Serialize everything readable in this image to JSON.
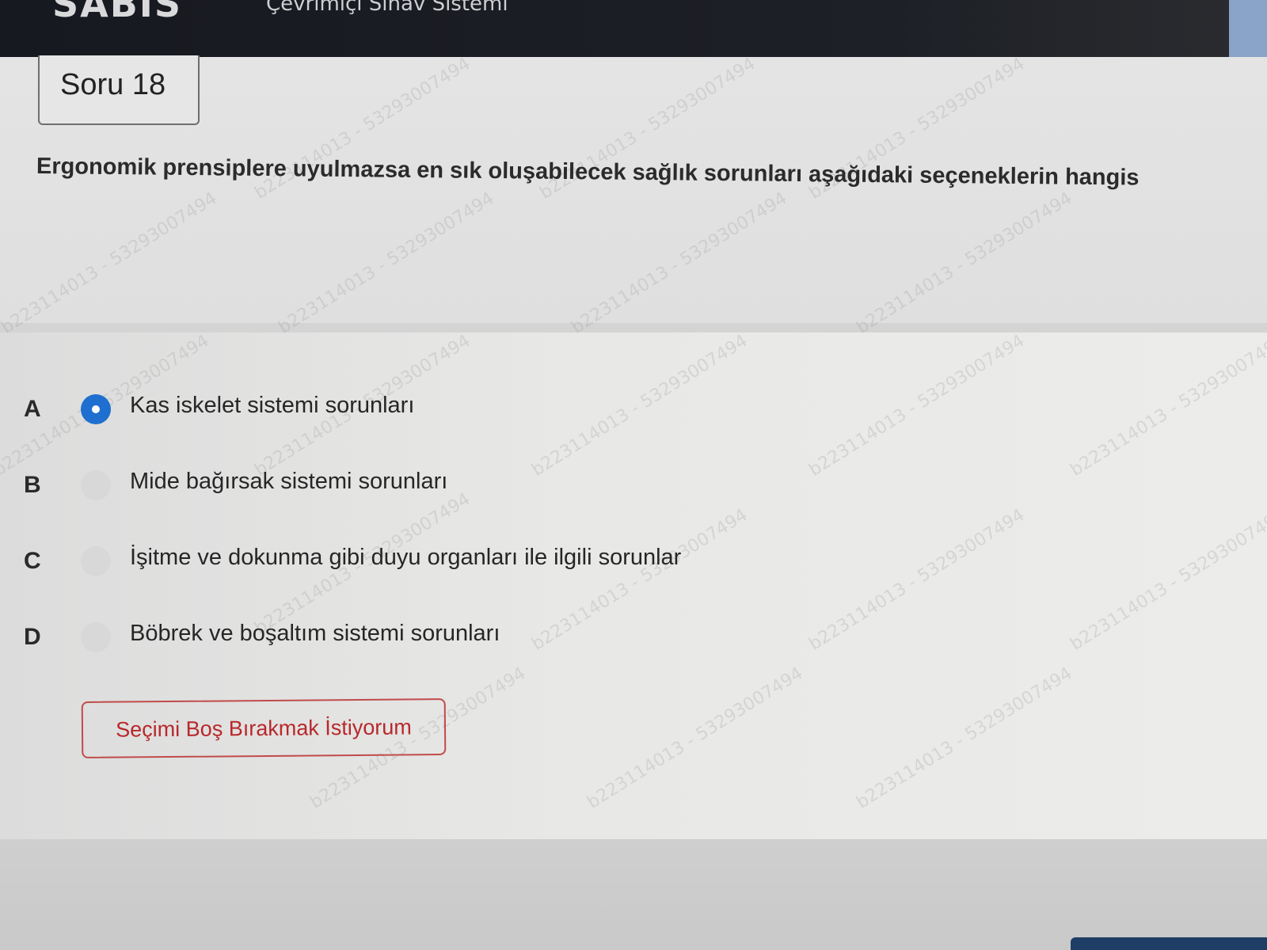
{
  "header": {
    "brand": "SABIS",
    "subtitle": "Çevrimiçi Sınav Sistemi"
  },
  "question": {
    "number_label": "Soru 18",
    "text": "Ergonomik prensiplere uyulmazsa en sık oluşabilecek sağlık sorunları aşağıdaki seçeneklerin hangis"
  },
  "options": [
    {
      "letter": "A",
      "label": "Kas iskelet sistemi sorunları",
      "selected": true
    },
    {
      "letter": "B",
      "label": "Mide bağırsak sistemi sorunları",
      "selected": false
    },
    {
      "letter": "C",
      "label": "İşitme ve dokunma gibi duyu organları ile ilgili sorunlar",
      "selected": false
    },
    {
      "letter": "D",
      "label": "Böbrek ve boşaltım sistemi sorunları",
      "selected": false
    }
  ],
  "skip_button": {
    "label": "Seçimi Boş Bırakmak İstiyorum"
  },
  "watermark": {
    "text": "b223114013 - 53293007494"
  },
  "colors": {
    "accent": "#1e6fd0",
    "danger": "#c14b4b",
    "header_bg": "#16191f"
  }
}
